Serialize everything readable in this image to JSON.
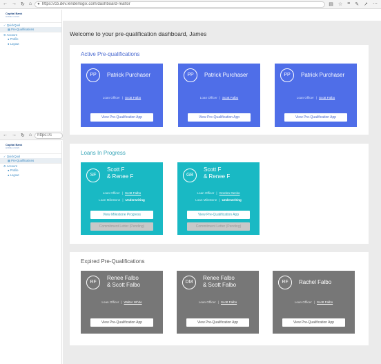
{
  "browser": {
    "url": "https://cb.dev.lenderlogix.com/dashboard-realtor",
    "url_short": "https://c"
  },
  "sidebar": {
    "logo_text": "Capital Bank",
    "logo_sub": "HOME LOANS",
    "sections": [
      {
        "label": "QuickQual",
        "items": [
          {
            "label": "Pre-Qualifications"
          }
        ]
      },
      {
        "label": "Account",
        "items": [
          {
            "label": "Profile"
          },
          {
            "label": "Logout"
          }
        ]
      }
    ]
  },
  "main": {
    "welcome": "Welcome to your pre-qualification dashboard, James",
    "active": {
      "title": "Active Pre-qualifications",
      "cards": [
        {
          "initials": "PP",
          "name": "Patrick Purchaser",
          "lo_label": "Loan Officer",
          "lo": "Scott Falbo",
          "button": "View Pre-Qualification App"
        },
        {
          "initials": "PP",
          "name": "Patrick Purchaser",
          "lo_label": "Loan Officer",
          "lo": "Scott Falbo",
          "button": "View Pre-Qualification App"
        },
        {
          "initials": "PP",
          "name": "Patrick Purchaser",
          "lo_label": "Loan Officer",
          "lo": "Scott Falbo",
          "button": "View Pre-Qualification App"
        }
      ]
    },
    "loans": {
      "title": "Loans In Progress",
      "cards": [
        {
          "initials": "SF",
          "name1": "Scott F",
          "name2": "& Renee F",
          "lo_label": "Loan Officer",
          "lo": "Scott Falbo",
          "ms_label": "Loan Milestone",
          "milestone": "Underwriting",
          "button": "View Milestone Progress",
          "button2": "Commitment Letter (Pending)"
        },
        {
          "initials": "GB",
          "name1": "Scott F",
          "name2": "& Renee F",
          "lo_label": "Loan Officer",
          "lo": "Gordon Gecko",
          "ms_label": "Loan Milestone",
          "milestone": "Underwriting",
          "button": "View Pre-Qualification App",
          "button2": "Commitment Letter (Pending)"
        }
      ]
    },
    "expired": {
      "title": "Expired Pre-Qualifications",
      "cards": [
        {
          "initials": "RF",
          "name1": "Renee Falbo",
          "name2": "& Scott Falbo",
          "lo_label": "Loan Officer",
          "lo": "Walter White",
          "button": "View Pre-Qualification App"
        },
        {
          "initials": "DM",
          "name1": "Renee Falbo",
          "name2": "& Scott Falbo",
          "lo_label": "Loan Officer",
          "lo": "Scott Falbo",
          "button": "View Pre-Qualification App"
        },
        {
          "initials": "RF",
          "name1": "Rachel Falbo",
          "name2": "",
          "lo_label": "Loan Officer",
          "lo": "Scott Falbo",
          "button": "View Pre-Qualification App"
        }
      ]
    }
  }
}
